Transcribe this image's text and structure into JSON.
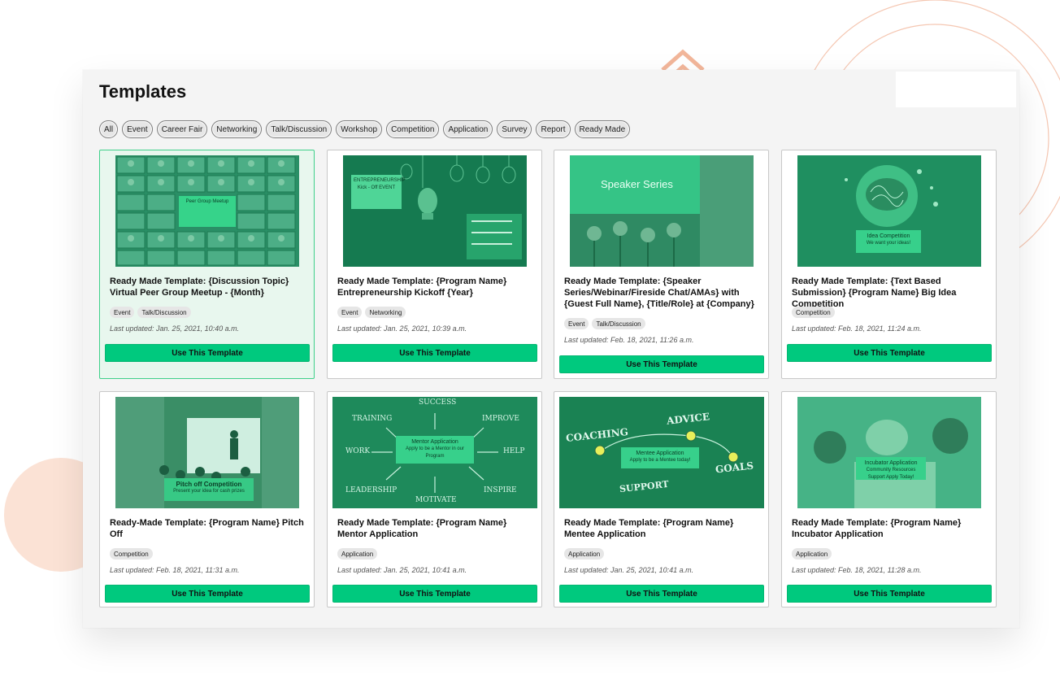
{
  "page": {
    "title": "Templates",
    "colors": {
      "accent": "#00c97e",
      "deco": "#f2b69a",
      "thumb_green": "#1f9a63"
    }
  },
  "filters": [
    "All",
    "Event",
    "Career Fair",
    "Networking",
    "Talk/Discussion",
    "Workshop",
    "Competition",
    "Application",
    "Survey",
    "Report",
    "Ready Made"
  ],
  "button_label": "Use This Template",
  "cards": [
    {
      "title": "Ready Made Template: {Discussion Topic} Virtual Peer Group Meetup - {Month}",
      "tags": [
        "Event",
        "Talk/Discussion"
      ],
      "updated": "Last updated: Jan. 25, 2021, 10:40 a.m.",
      "thumb_text": "Peer Group Meetup",
      "thumb_icon": "video-grid-image",
      "selected": true
    },
    {
      "title": "Ready Made Template: {Program Name} Entrepreneurship Kickoff {Year}",
      "tags": [
        "Event",
        "Networking"
      ],
      "updated": "Last updated: Jan. 25, 2021, 10:39 a.m.",
      "thumb_text": "ENTREPRENEURSHIP Kick - Off EVENT",
      "thumb_icon": "lightbulb-image",
      "selected": false
    },
    {
      "title": "Ready Made Template: {Speaker Series/Webinar/Fireside Chat/AMAs} with {Guest Full Name}, {Title/Role} at {Company}",
      "tags": [
        "Event",
        "Talk/Discussion"
      ],
      "updated": "Last updated: Feb. 18, 2021, 11:26 a.m.",
      "thumb_text": "Speaker Series",
      "thumb_icon": "microphones-image",
      "selected": false
    },
    {
      "title": "Ready Made Template: {Text Based Submission} {Program Name} Big Idea Competition",
      "tags": [
        "Competition"
      ],
      "updated": "Last updated: Feb. 18, 2021, 11:24 a.m.",
      "thumb_text": "Idea Competition",
      "thumb_subtext": "We want your ideas!",
      "thumb_icon": "brain-bulb-image",
      "selected": false
    },
    {
      "title": "Ready-Made Template: {Program Name} Pitch Off",
      "tags": [
        "Competition"
      ],
      "updated": "Last updated: Feb. 18, 2021, 11:31 a.m.",
      "thumb_text": "Pitch off Competition",
      "thumb_subtext": "Present your idea for cash prizes",
      "thumb_icon": "presentation-image",
      "selected": false
    },
    {
      "title": "Ready Made Template: {Program Name} Mentor Application",
      "tags": [
        "Application"
      ],
      "updated": "Last updated: Jan. 25, 2021, 10:41 a.m.",
      "thumb_text": "Mentor Application",
      "thumb_subtext": "Apply to be a Mentor in our Program",
      "thumb_icon": "chalkboard-image",
      "thumb_words": [
        "SUCCESS",
        "TRAINING",
        "IMPROVE",
        "WORK",
        "HELP",
        "LEADERSHIP",
        "INSPIRE",
        "MOTIVATE"
      ],
      "selected": false
    },
    {
      "title": "Ready Made Template: {Program Name} Mentee Application",
      "tags": [
        "Application"
      ],
      "updated": "Last updated: Jan. 25, 2021, 10:41 a.m.",
      "thumb_text": "Mentee Application",
      "thumb_subtext": "Apply to be a Mentee today!",
      "thumb_icon": "coaching-board-image",
      "thumb_words": [
        "COACHING",
        "ADVICE",
        "GOALS",
        "SUPPORT"
      ],
      "selected": false
    },
    {
      "title": "Ready Made Template: {Program Name} Incubator Application",
      "tags": [
        "Application"
      ],
      "updated": "Last updated: Feb. 18, 2021, 11:28 a.m.",
      "thumb_text": "Incubator Application",
      "thumb_subtext": "Community Resources Support Apply Today!",
      "thumb_icon": "high-five-image",
      "selected": false
    }
  ]
}
